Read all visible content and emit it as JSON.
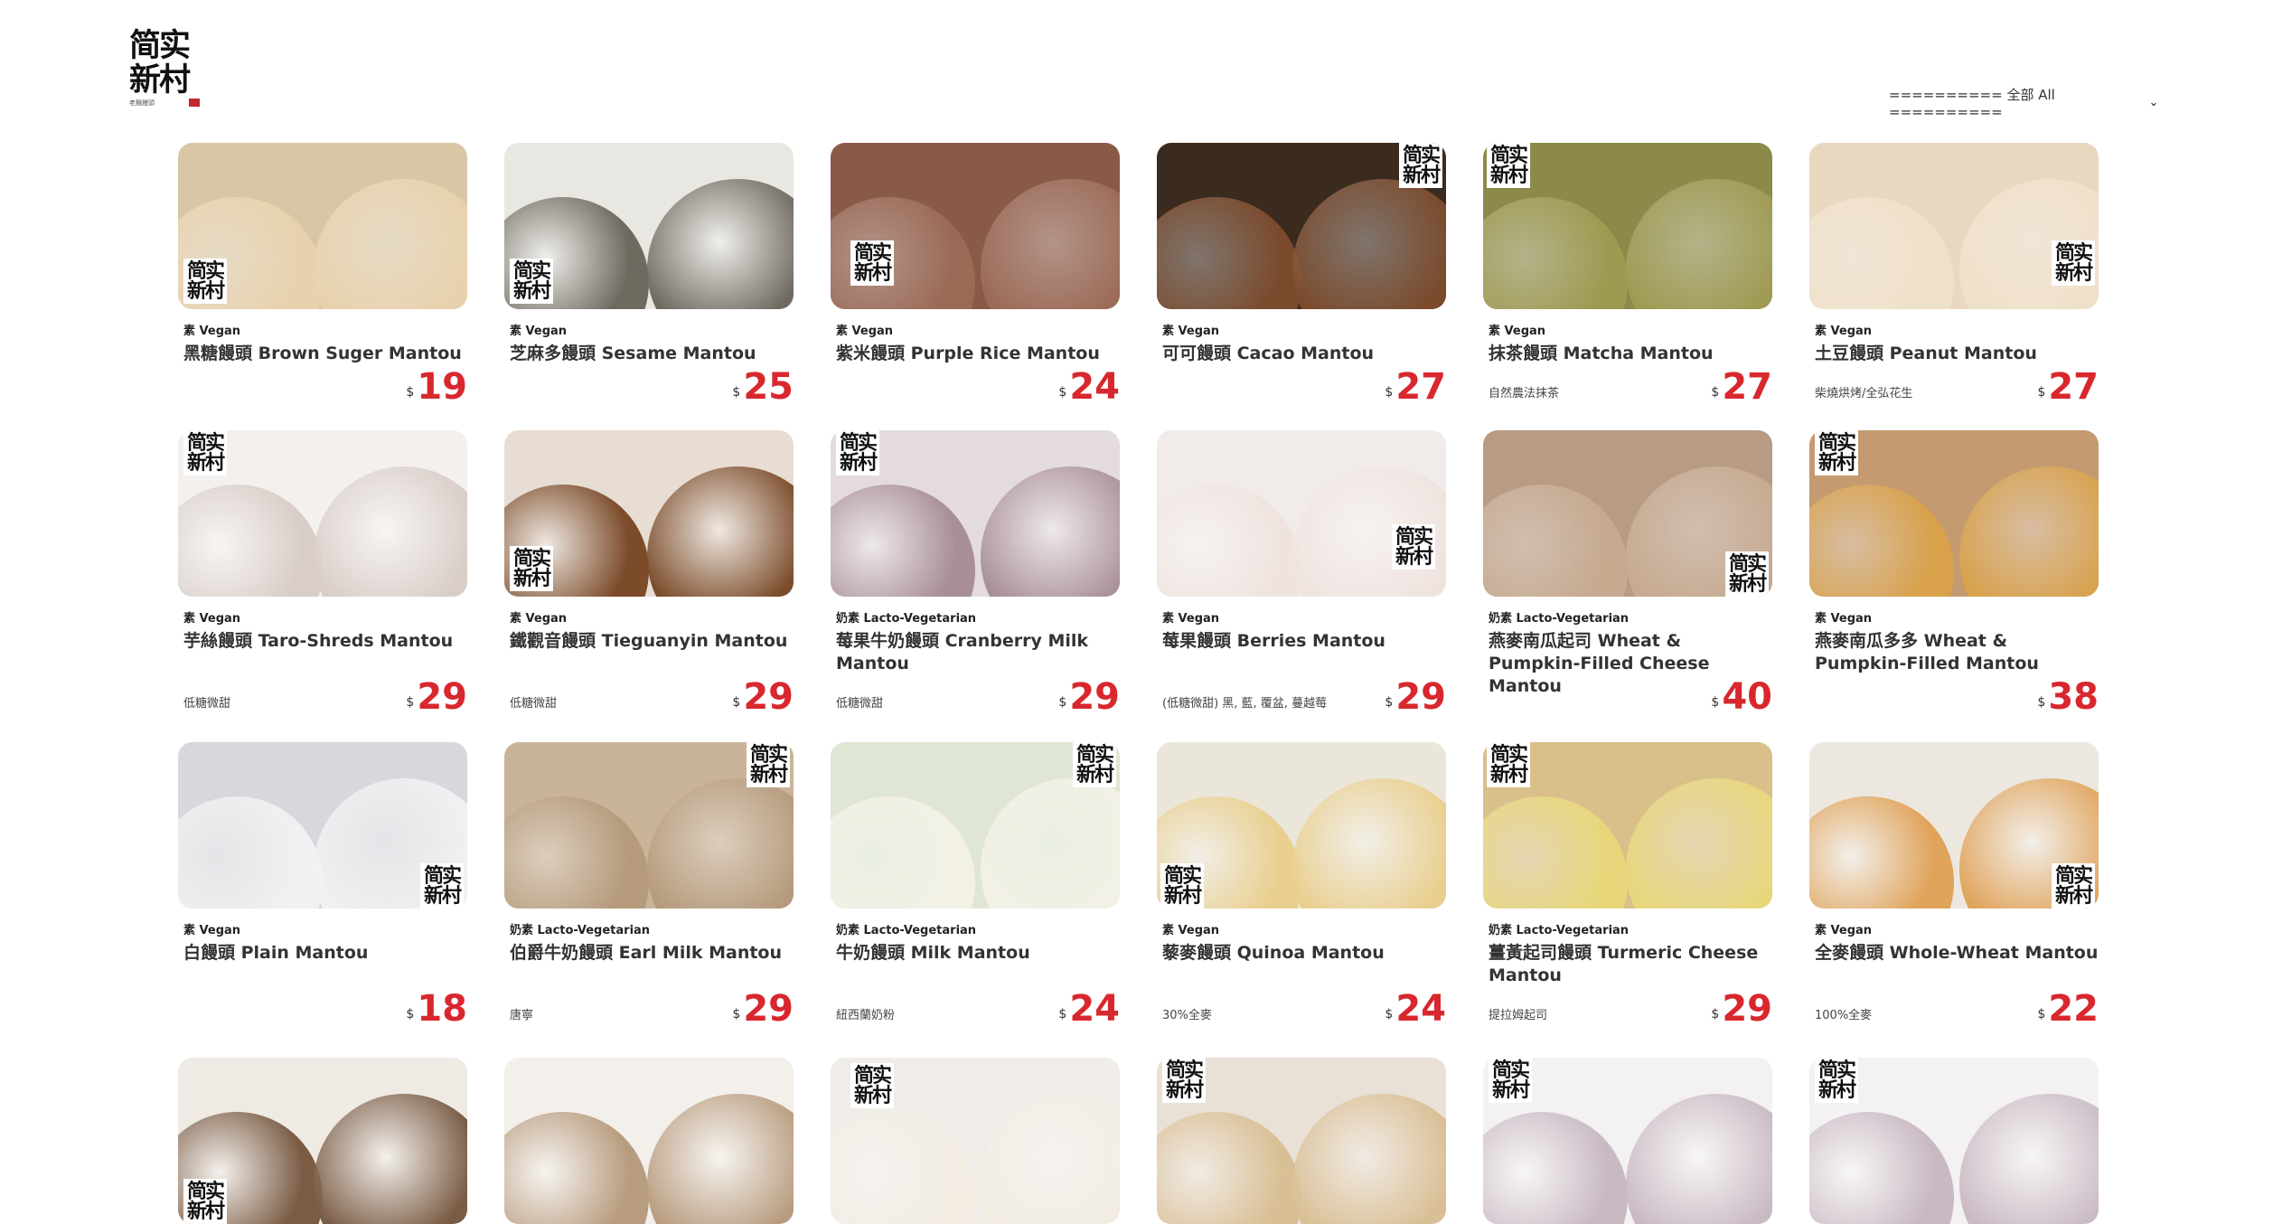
{
  "brand": {
    "logo_glyphs": [
      "简实",
      "新村"
    ],
    "logo_sub": "老麵饅頭"
  },
  "filter": {
    "selected": "========== 全部 All =========="
  },
  "products": [
    {
      "diet": "素 Vegan",
      "name": "黑糖饅頭 Brown Suger Mantou",
      "note": "",
      "currency": "$",
      "price": "19",
      "bg": "#d9c6a6",
      "bun": "#e8d2ad"
    },
    {
      "diet": "素 Vegan",
      "name": "芝麻多饅頭 Sesame Mantou",
      "note": "",
      "currency": "$",
      "price": "25",
      "bg": "#e9e7e1",
      "bun": "#6f6a60"
    },
    {
      "diet": "素 Vegan",
      "name": "紫米饅頭 Purple Rice Mantou",
      "note": "",
      "currency": "$",
      "price": "24",
      "bg": "#8a5a48",
      "bun": "#9b6956"
    },
    {
      "diet": "素 Vegan",
      "name": "可可饅頭 Cacao Mantou",
      "note": "",
      "currency": "$",
      "price": "27",
      "bg": "#3b2a1e",
      "bun": "#7b4a2c"
    },
    {
      "diet": "素 Vegan",
      "name": "抹茶饅頭 Matcha Mantou",
      "note": "自然農法抹茶",
      "currency": "$",
      "price": "27",
      "bg": "#8b8a4a",
      "bun": "#9f9a52"
    },
    {
      "diet": "素 Vegan",
      "name": "土豆饅頭 Peanut Mantou",
      "note": "柴燒烘烤/全弘花生",
      "currency": "$",
      "price": "27",
      "bg": "#e9d8c0",
      "bun": "#efe0c8"
    },
    {
      "diet": "素 Vegan",
      "name": "芋絲饅頭 Taro-Shreds Mantou",
      "note": "低糖微甜",
      "currency": "$",
      "price": "29",
      "bg": "#f3f0ee",
      "bun": "#d9cdc8"
    },
    {
      "diet": "素 Vegan",
      "name": "鐵觀音饅頭 Tieguanyin Mantou",
      "note": "低糖微甜",
      "currency": "$",
      "price": "29",
      "bg": "#e7ddd3",
      "bun": "#7b4b2a"
    },
    {
      "diet": "奶素 Lacto-Vegetarian",
      "name": "莓果牛奶饅頭 Cranberry Milk Mantou",
      "note": "低糖微甜",
      "currency": "$",
      "price": "29",
      "bg": "#e4dcdc",
      "bun": "#a88f97"
    },
    {
      "diet": "素 Vegan",
      "name": "莓果饅頭 Berries Mantou",
      "note": "(低糖微甜) 黑, 藍, 覆盆, 蔓越莓",
      "currency": "$",
      "price": "29",
      "bg": "#f1ece9",
      "bun": "#efe3df"
    },
    {
      "diet": "奶素 Lacto-Vegetarian",
      "name": "燕麥南瓜起司 Wheat & Pumpkin-Filled Cheese Mantou",
      "note": "",
      "currency": "$",
      "price": "40",
      "bg": "#b79b85",
      "bun": "#c6a98f"
    },
    {
      "diet": "素 Vegan",
      "name": "燕麥南瓜多多 Wheat & Pumpkin-Filled Mantou",
      "note": "",
      "currency": "$",
      "price": "38",
      "bg": "#c49a70",
      "bun": "#d8a14a"
    },
    {
      "diet": "素 Vegan",
      "name": "白饅頭 Plain Mantou",
      "note": "",
      "currency": "$",
      "price": "18",
      "bg": "#d7d7dc",
      "bun": "#f1f0f2"
    },
    {
      "diet": "奶素 Lacto-Vegetarian",
      "name": "伯爵牛奶饅頭 Earl Milk Mantou",
      "note": "唐寧",
      "currency": "$",
      "price": "29",
      "bg": "#c9b49a",
      "bun": "#b59a7c"
    },
    {
      "diet": "奶素 Lacto-Vegetarian",
      "name": "牛奶饅頭 Milk Mantou",
      "note": "紐西蘭奶粉",
      "currency": "$",
      "price": "24",
      "bg": "#dfe6d4",
      "bun": "#f3f1e6"
    },
    {
      "diet": "素 Vegan",
      "name": "藜麥饅頭 Quinoa Mantou",
      "note": "30%全麥",
      "currency": "$",
      "price": "24",
      "bg": "#eae6da",
      "bun": "#e9cf8f"
    },
    {
      "diet": "奶素 Lacto-Vegetarian",
      "name": "薑黃起司饅頭 Turmeric Cheese Mantou",
      "note": "提拉姆起司",
      "currency": "$",
      "price": "29",
      "bg": "#d9c08a",
      "bun": "#e7d77a"
    },
    {
      "diet": "素 Vegan",
      "name": "全麥饅頭 Whole-Wheat Mantou",
      "note": "100%全麥",
      "currency": "$",
      "price": "22",
      "bg": "#ece7df",
      "bun": "#e0a35a"
    },
    {
      "diet": "",
      "name": "",
      "note": "",
      "currency": "",
      "price": "",
      "bg": "#efeae4",
      "bun": "#7a5c45"
    },
    {
      "diet": "",
      "name": "",
      "note": "",
      "currency": "",
      "price": "",
      "bg": "#f3efea",
      "bun": "#b89c7f"
    },
    {
      "diet": "",
      "name": "",
      "note": "",
      "currency": "",
      "price": "",
      "bg": "#f0ece8",
      "bun": "#f2ece2"
    },
    {
      "diet": "",
      "name": "",
      "note": "",
      "currency": "",
      "price": "",
      "bg": "#e9e0d6",
      "bun": "#d9bf95"
    },
    {
      "diet": "",
      "name": "",
      "note": "",
      "currency": "",
      "price": "",
      "bg": "#f3f1f2",
      "bun": "#c9b9c3"
    },
    {
      "diet": "",
      "name": "",
      "note": "",
      "currency": "",
      "price": "",
      "bg": "#f3f1f2",
      "bun": "#c9b9c3"
    }
  ]
}
